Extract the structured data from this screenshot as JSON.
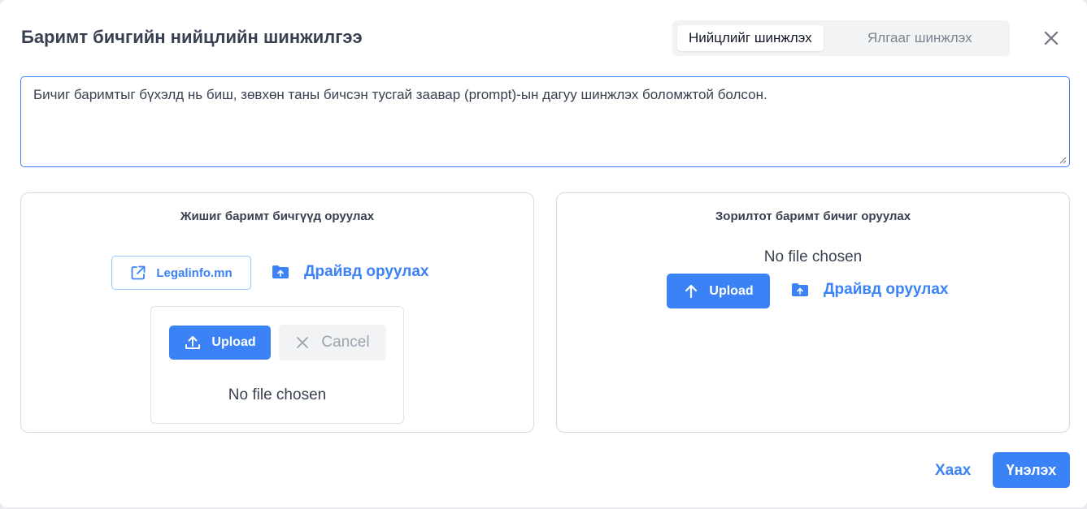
{
  "dialog": {
    "title": "Баримт бичгийн нийцлийн шинжилгээ",
    "modes": [
      {
        "label": "Нийцлийг шинжлэх",
        "active": true
      },
      {
        "label": "Ялгааг шинжлэх",
        "active": false
      }
    ],
    "close_icon": "close-icon"
  },
  "prompt": {
    "value": "Бичиг баримтыг бүхэлд нь биш, зөвхөн таны бичсэн тусгай заавар (prompt)-ын дагуу шинжлэх боломжтой болсон."
  },
  "sample_panel": {
    "title": "Жишиг баримт бичгүүд оруулах",
    "legalinfo_label": "Legalinfo.mn",
    "drive_label": "Драйвд оруулах",
    "upload_label": "Upload",
    "cancel_label": "Cancel",
    "no_file": "No file chosen"
  },
  "target_panel": {
    "title": "Зорилтот баримт бичиг оруулах",
    "no_file": "No file chosen",
    "upload_label": "Upload",
    "drive_label": "Драйвд оруулах"
  },
  "footer": {
    "close_label": "Хаах",
    "submit_label": "Үнэлэх"
  },
  "colors": {
    "accent": "#3b82f6",
    "border": "#d7dadf",
    "segment_bg": "#f1f3f5"
  }
}
